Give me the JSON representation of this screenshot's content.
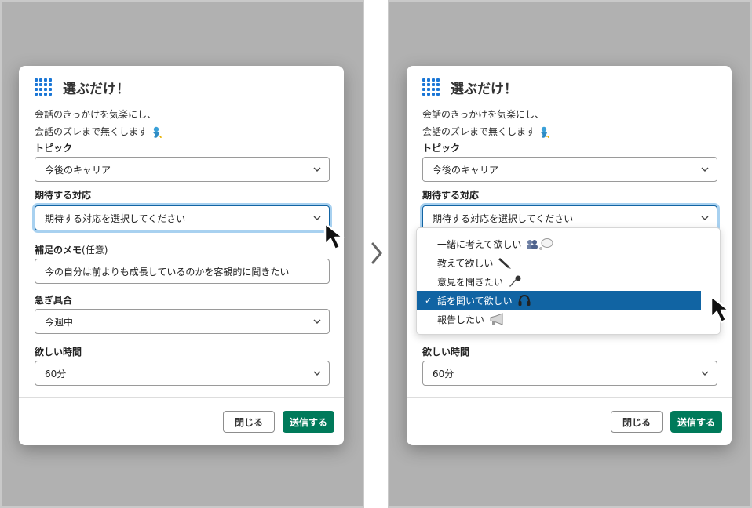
{
  "form": {
    "title": "選ぶだけ！",
    "desc_line1": "会話のきっかけを気楽にし、",
    "desc_line2": "会話のズレまで無くします",
    "topic_label": "トピック",
    "topic_value": "今後のキャリア",
    "expect_label": "期待する対応",
    "expect_placeholder": "期待する対応を選択してください",
    "memo_label": "補足のメモ",
    "memo_optional": "(任意)",
    "memo_value": "今の自分は前よりも成長しているのかを客観的に聞きたい",
    "urgency_label": "急ぎ具合",
    "urgency_value": "今週中",
    "time_label": "欲しい時間",
    "time_value": "60分",
    "close_label": "閉じる",
    "send_label": "送信する"
  },
  "dropdown": {
    "options": [
      {
        "label": "一緒に考えて欲しい",
        "emoji": "people-thought-icon"
      },
      {
        "label": "教えて欲しい",
        "emoji": "pen-icon"
      },
      {
        "label": "意見を聞きたい",
        "emoji": "microphone-icon"
      },
      {
        "label": "話を聞いて欲しい",
        "emoji": "headphones-icon",
        "selected": true
      },
      {
        "label": "報告したい",
        "emoji": "megaphone-icon"
      }
    ],
    "check": "✓"
  },
  "colors": {
    "brand_grid": "#1b77d6",
    "send_button": "#007a5a",
    "focus_ring": "#a8d1f0",
    "selected_row": "#1164a3",
    "backdrop": "#b1b1b1"
  }
}
